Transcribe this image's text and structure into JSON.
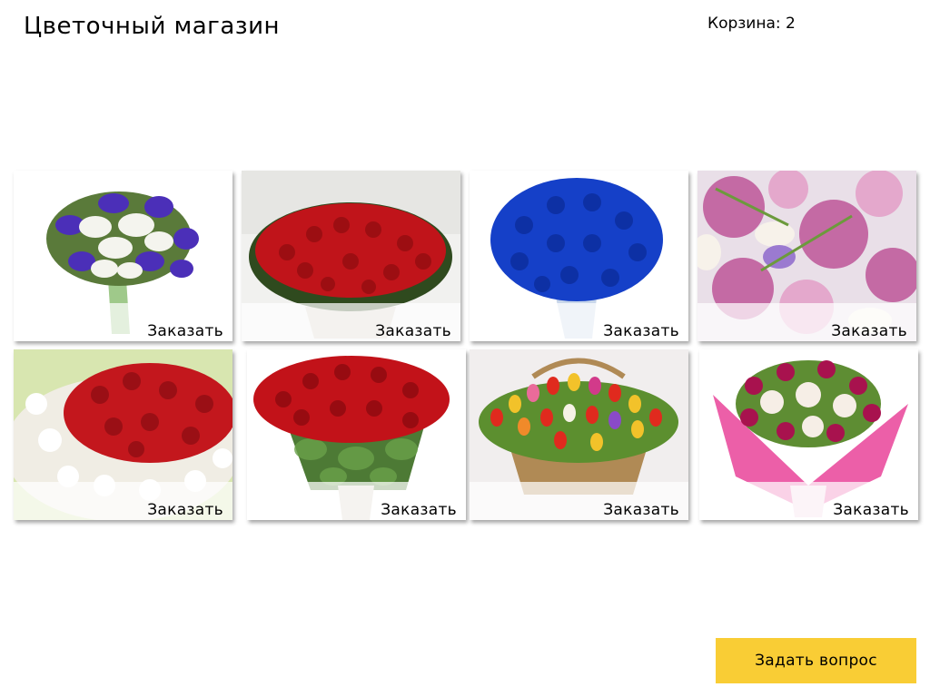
{
  "header": {
    "title": "Цветочный магазин",
    "cart_label": "Корзина: 2"
  },
  "products": [
    {
      "image": "lilies-and-irises-bouquet",
      "order_label": "Заказать"
    },
    {
      "image": "red-roses-basket",
      "order_label": "Заказать"
    },
    {
      "image": "blue-roses-bouquet",
      "order_label": "Заказать"
    },
    {
      "image": "pink-roses-and-freesias",
      "order_label": "Заказать"
    },
    {
      "image": "red-and-white-roses-arrangement",
      "order_label": "Заказать"
    },
    {
      "image": "red-roses-bouquet",
      "order_label": "Заказать"
    },
    {
      "image": "tulips-basket",
      "order_label": "Заказать"
    },
    {
      "image": "pink-chrysanthemums-bouquet",
      "order_label": "Заказать"
    }
  ],
  "ask_button": {
    "label": "Задать вопрос"
  },
  "colors": {
    "ask_button_bg": "#f9cd35",
    "page_bg": "#ffffff"
  }
}
